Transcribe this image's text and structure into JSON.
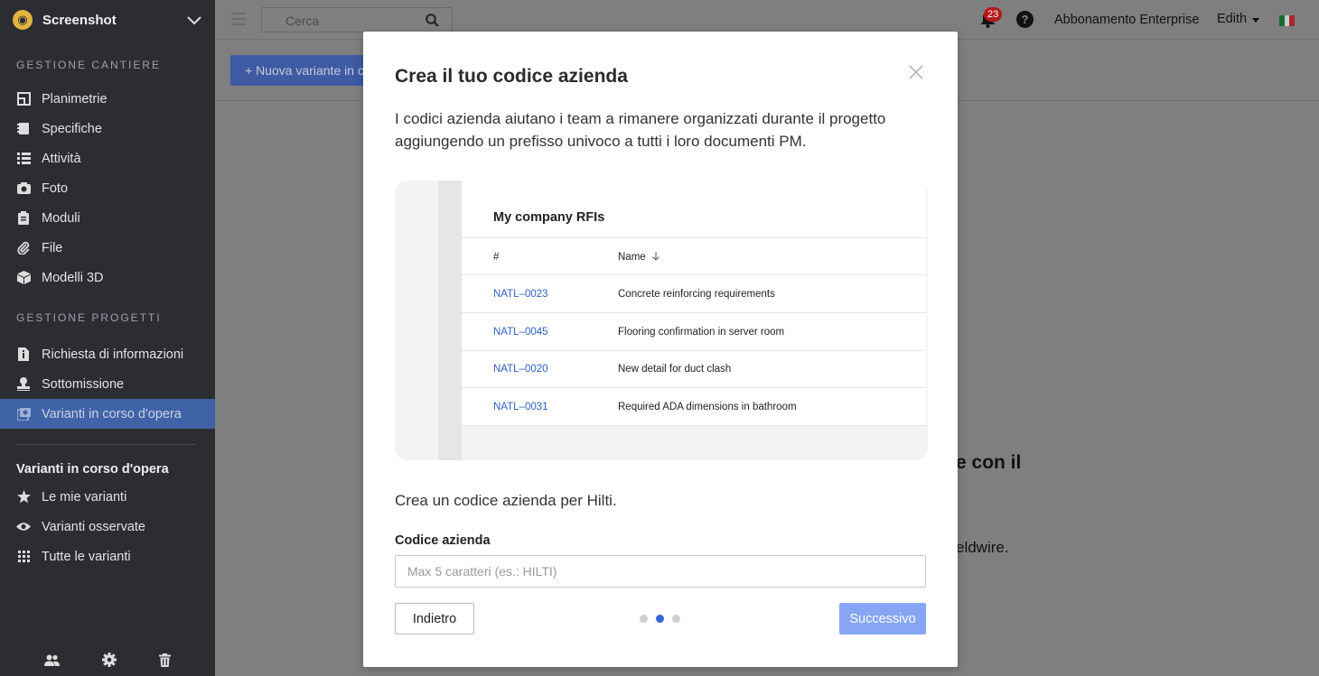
{
  "sidebar": {
    "brand": "Screenshot",
    "section1_title": "GESTIONE CANTIERE",
    "section1_items": [
      {
        "label": "Planimetrie",
        "icon": "floorplan-icon"
      },
      {
        "label": "Specifiche",
        "icon": "book-icon"
      },
      {
        "label": "Attività",
        "icon": "list-icon"
      },
      {
        "label": "Foto",
        "icon": "camera-icon"
      },
      {
        "label": "Moduli",
        "icon": "clipboard-icon"
      },
      {
        "label": "File",
        "icon": "paperclip-icon"
      },
      {
        "label": "Modelli 3D",
        "icon": "cube-icon"
      }
    ],
    "section2_title": "GESTIONE PROGETTI",
    "section2_items": [
      {
        "label": "Richiesta di informazioni",
        "icon": "info-doc-icon"
      },
      {
        "label": "Sottomissione",
        "icon": "stamp-icon"
      },
      {
        "label": "Varianti in corso d'opera",
        "icon": "change-order-icon",
        "active": true
      }
    ],
    "sub_title": "Varianti in corso d'opera",
    "sub_items": [
      {
        "label": "Le mie varianti",
        "icon": "star-icon"
      },
      {
        "label": "Varianti osservate",
        "icon": "eye-icon"
      },
      {
        "label": "Tutte le varianti",
        "icon": "grid-icon"
      }
    ]
  },
  "topbar": {
    "search_placeholder": "Cerca",
    "notifications_count": "23",
    "help": "?",
    "subscription": "Abbonamento Enterprise",
    "user": "Edith"
  },
  "toolbar": {
    "new_button": "+ Nuova variante in corso d'opera"
  },
  "background": {
    "fragment1": "e con il",
    "fragment2": "eldwire."
  },
  "modal": {
    "title": "Crea il tuo codice azienda",
    "description": "I codici azienda aiutano i team a rimanere organizzati durante il progetto aggiungendo un prefisso univoco a tutti i loro documenti PM.",
    "preview": {
      "title": "My company RFIs",
      "col_number": "#",
      "col_name": "Name",
      "rows": [
        {
          "code": "NATL–0023",
          "name": "Concrete reinforcing requirements"
        },
        {
          "code": "NATL–0045",
          "name": "Flooring confirmation in server room"
        },
        {
          "code": "NATL–0020",
          "name": "New detail for duct clash"
        },
        {
          "code": "NATL–0031",
          "name": "Required ADA dimensions in bathroom"
        }
      ]
    },
    "prompt": "Crea un codice azienda per Hilti.",
    "field_label": "Codice azienda",
    "field_placeholder": "Max 5 caratteri (es.: HILTI)",
    "field_value": "",
    "back_label": "Indietro",
    "next_label": "Successivo",
    "step_current": 2,
    "step_total": 3
  },
  "colors": {
    "sidebar_bg": "#2b2d33",
    "active_item": "#3f63a6",
    "link": "#2f5fc4",
    "primary_disabled": "#86a6f3",
    "badge": "#b51a1a"
  }
}
